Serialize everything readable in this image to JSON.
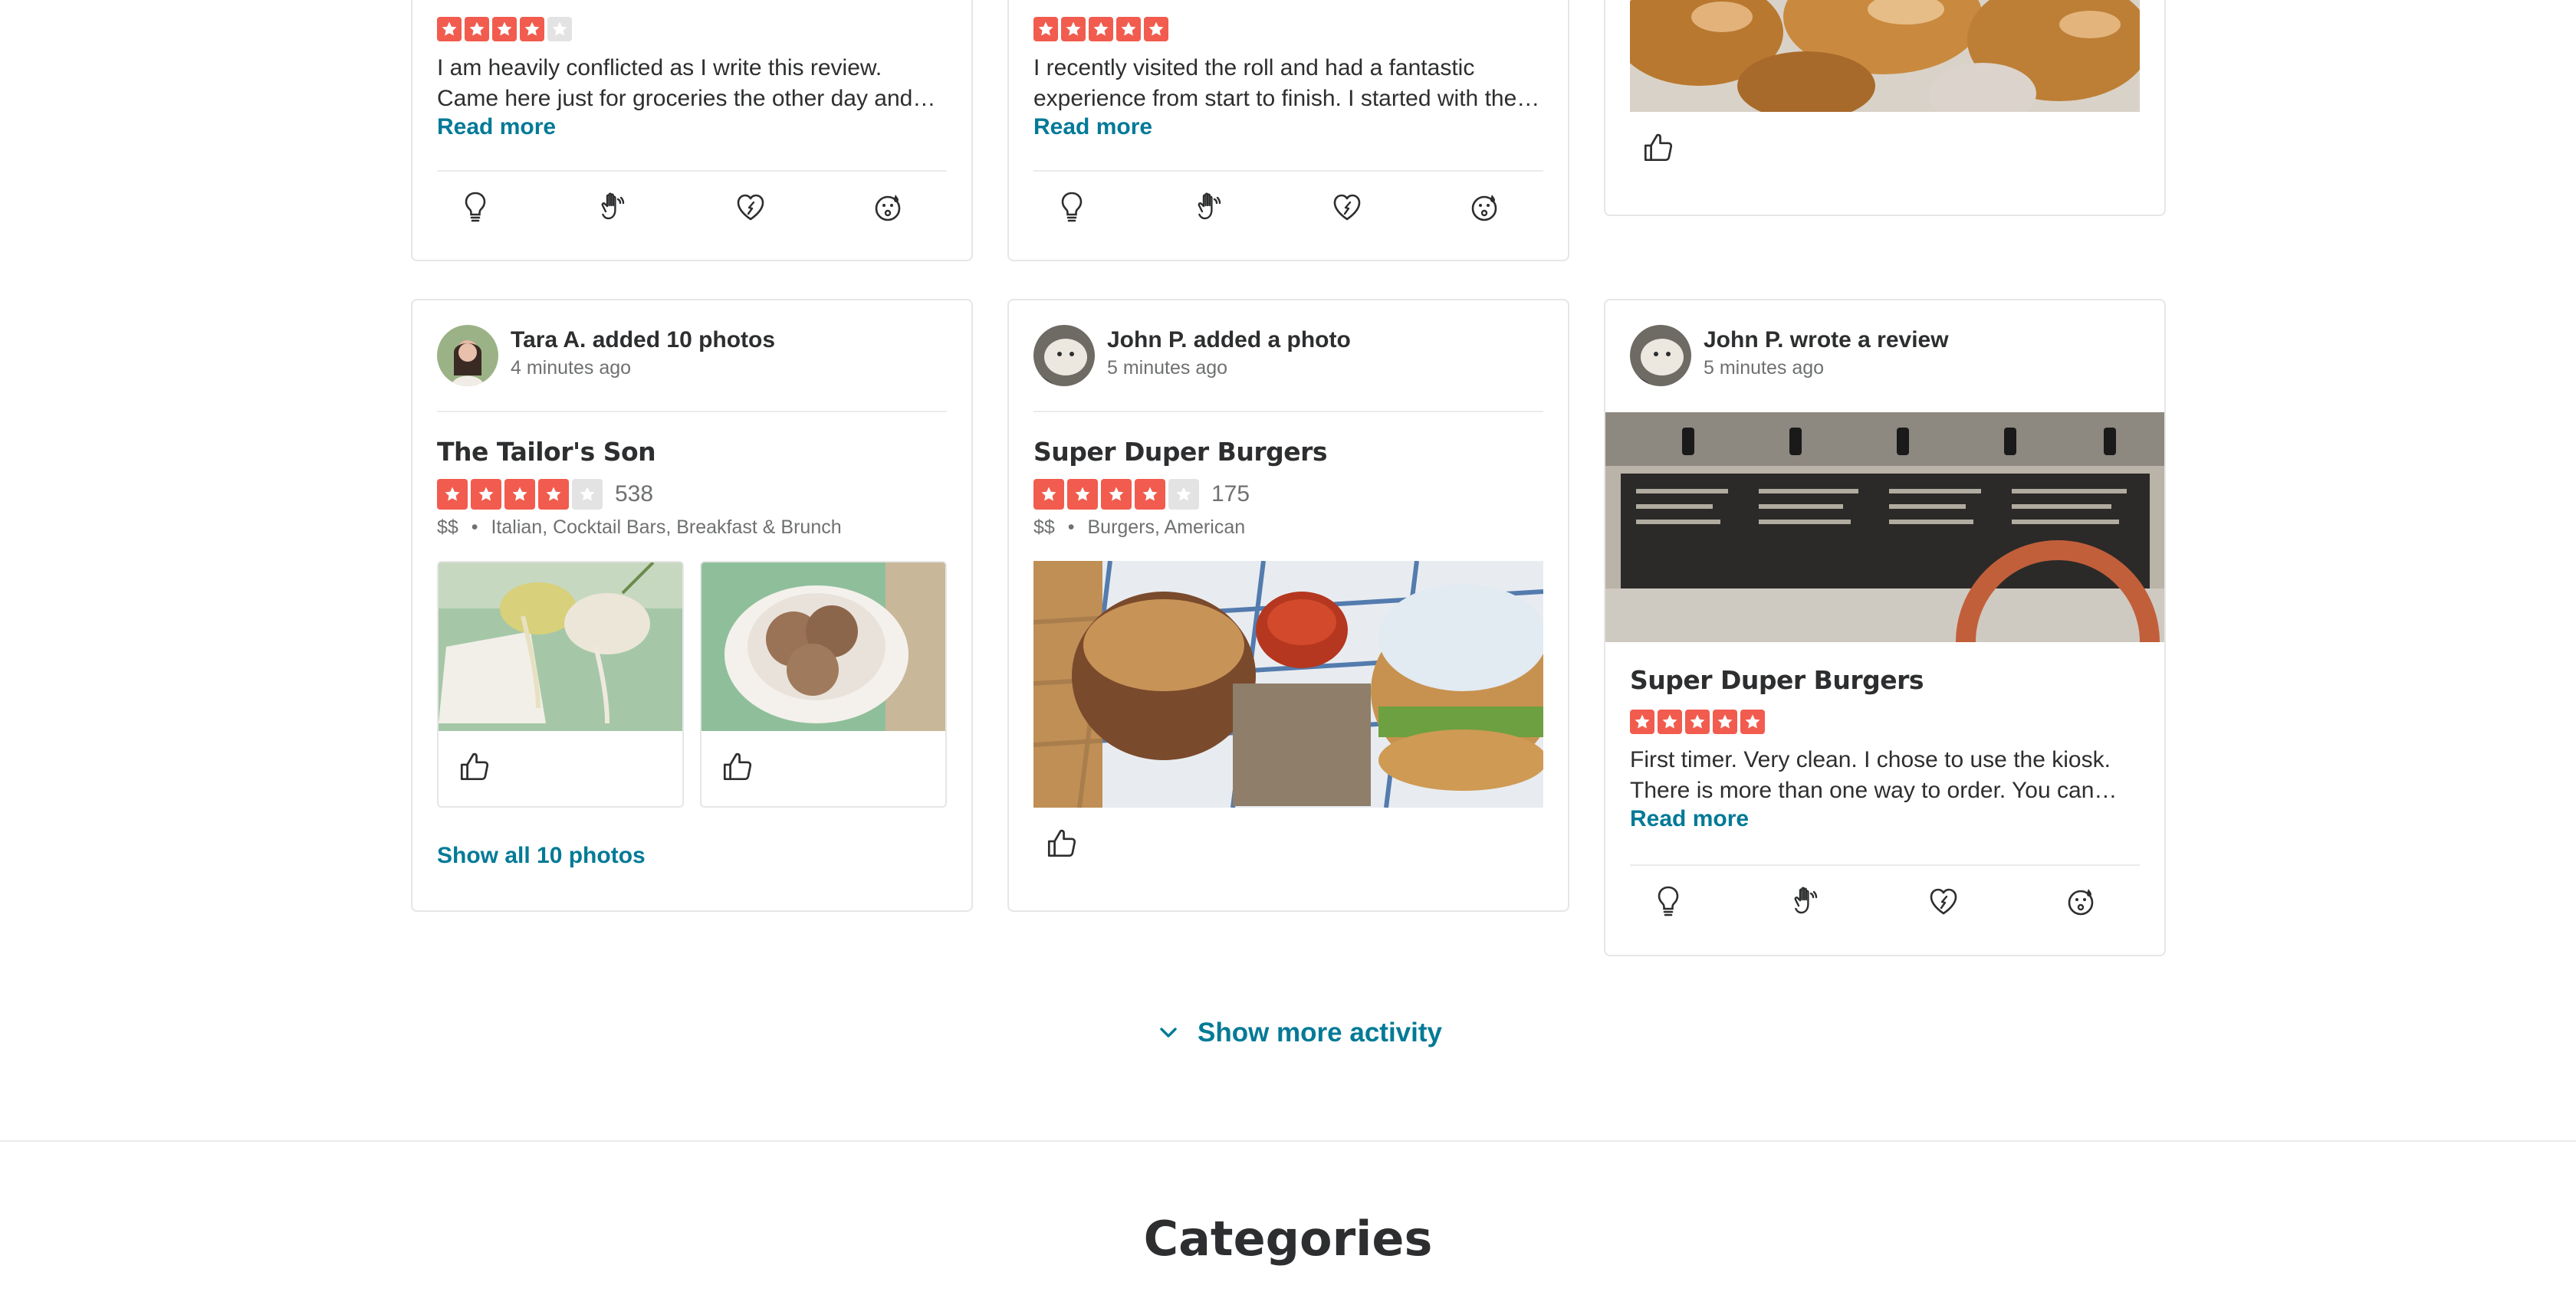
{
  "top_cards": [
    {
      "rating": 4,
      "text": "I am heavily conflicted as I write this review. Came here just for groceries the other day and…",
      "read_more": "Read more"
    },
    {
      "rating": 5,
      "text": "I recently visited the roll and had a fantastic experience from start to finish. I started with the…",
      "read_more": "Read more"
    }
  ],
  "activity": [
    {
      "user": "Tara A.",
      "action": "Tara A. added 10 photos",
      "time": "4 minutes ago",
      "business": "The Tailor's Son",
      "rating": 4,
      "review_count": "538",
      "price": "$$",
      "categories": "Italian, Cocktail Bars, Breakfast & Brunch",
      "show_all": "Show all 10 photos"
    },
    {
      "user": "John P.",
      "action": "John P. added a photo",
      "time": "5 minutes ago",
      "business": "Super Duper Burgers",
      "rating": 4,
      "review_count": "175",
      "price": "$$",
      "categories": "Burgers, American"
    },
    {
      "user": "John P.",
      "action": "John P. wrote a review",
      "time": "5 minutes ago",
      "business": "Super Duper Burgers",
      "rating": 5,
      "text": "First timer. Very clean. I chose to use the kiosk. There is more than one way to order. You can…",
      "read_more": "Read more"
    }
  ],
  "show_more": "Show more activity",
  "section_title": "Categories",
  "icons": {
    "reactions": [
      "lightbulb-icon",
      "clapping-hands-icon",
      "heart-icon",
      "emoji-oh-no-icon"
    ],
    "like": "thumbs-up-icon",
    "chevron": "chevron-down-icon"
  },
  "colors": {
    "star_red": "#f15c4f",
    "link_teal": "#027a97"
  }
}
